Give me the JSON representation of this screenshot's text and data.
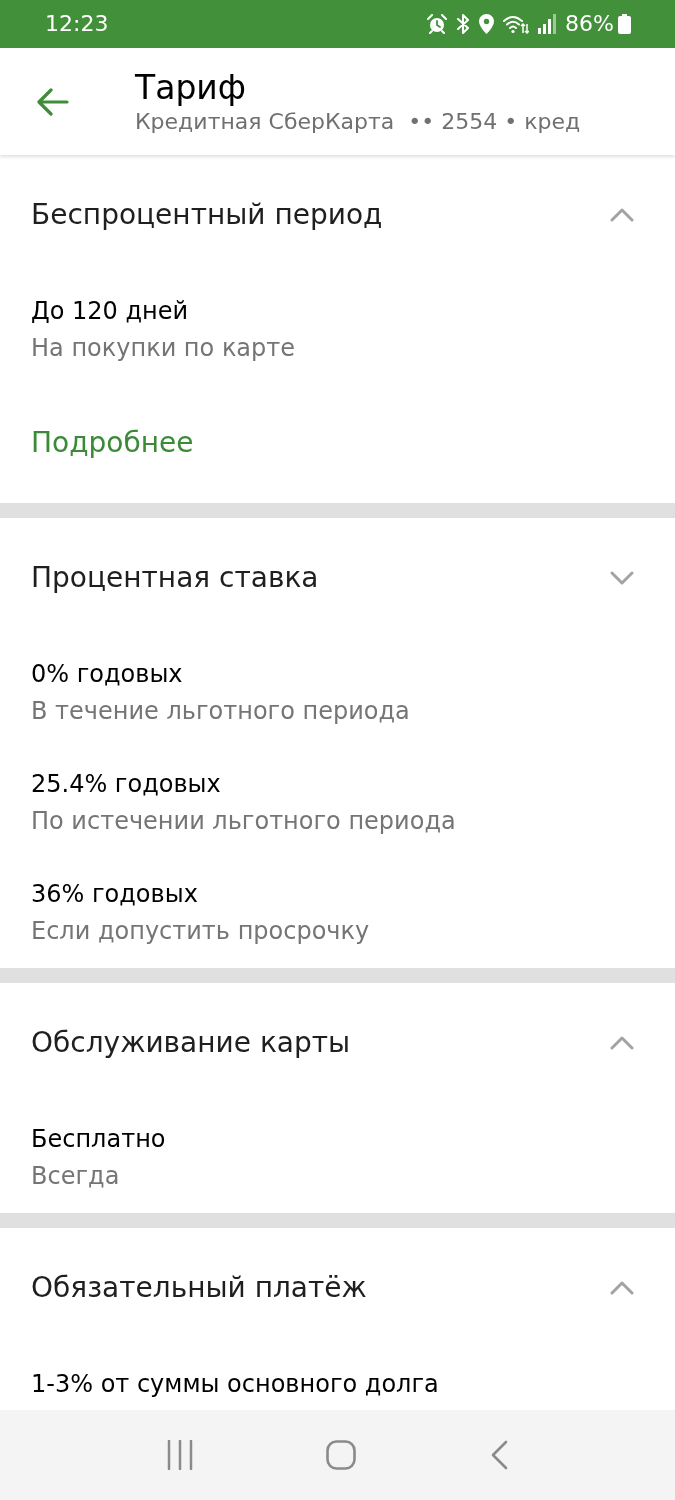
{
  "status_bar": {
    "time": "12:23",
    "battery": "86%"
  },
  "header": {
    "title": "Тариф",
    "card_name": "Кредитная СберКарта",
    "card_info": "•• 2554 • кред"
  },
  "sections": [
    {
      "title": "Беспроцентный период",
      "expanded": true,
      "items": [
        {
          "title": "До 120 дней",
          "subtitle": "На покупки по карте"
        }
      ],
      "link": "Подробнее"
    },
    {
      "title": "Процентная ставка",
      "expanded": false,
      "items": [
        {
          "title": "0% годовых",
          "subtitle": "В течение льготного периода"
        },
        {
          "title": "25.4% годовых",
          "subtitle": "По истечении льготного периода"
        },
        {
          "title": "36% годовых",
          "subtitle": "Если допустить просрочку"
        }
      ]
    },
    {
      "title": "Обслуживание карты",
      "expanded": true,
      "items": [
        {
          "title": "Бесплатно",
          "subtitle": "Всегда"
        }
      ]
    },
    {
      "title": "Обязательный платёж",
      "expanded": true,
      "items": [
        {
          "title": "1-3% от суммы основного долга"
        }
      ]
    }
  ]
}
